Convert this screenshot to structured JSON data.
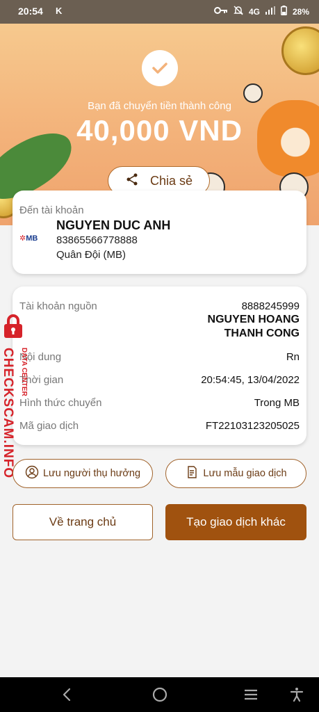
{
  "status_bar": {
    "time": "20:54",
    "left_icon": "K",
    "network": "4G",
    "battery": "28%"
  },
  "hero": {
    "subtitle": "Bạn đã chuyển tiền thành công",
    "amount": "40,000 VND",
    "share_label": "Chia sẻ"
  },
  "destination": {
    "label": "Đến tài khoản",
    "bank_logo": "MB",
    "name": "NGUYEN DUC ANH",
    "account": "83865566778888",
    "bank": "Quân Đội (MB)"
  },
  "details": {
    "source_label": "Tài khoản nguồn",
    "source_account": "8888245999",
    "source_name_line1": "NGUYEN HOANG",
    "source_name_line2": "THANH CONG",
    "content_label": "Nội dung",
    "content_value": "Rn",
    "time_label": "Thời gian",
    "time_value": "20:54:45, 13/04/2022",
    "method_label": "Hình thức chuyển",
    "method_value": "Trong MB",
    "txn_label": "Mã giao dịch",
    "txn_value": "FT22103123205025"
  },
  "watermark": {
    "main": "CHECKSCAM.INFO",
    "sub": "DATA CENTER"
  },
  "actions": {
    "save_recipient": "Lưu người thụ hưởng",
    "save_template": "Lưu mẫu giao dịch",
    "home": "Về trang chủ",
    "new_transaction": "Tạo giao dịch khác"
  },
  "colors": {
    "accent": "#a0520f",
    "outline": "#a0622a",
    "watermark": "#d6232a"
  }
}
